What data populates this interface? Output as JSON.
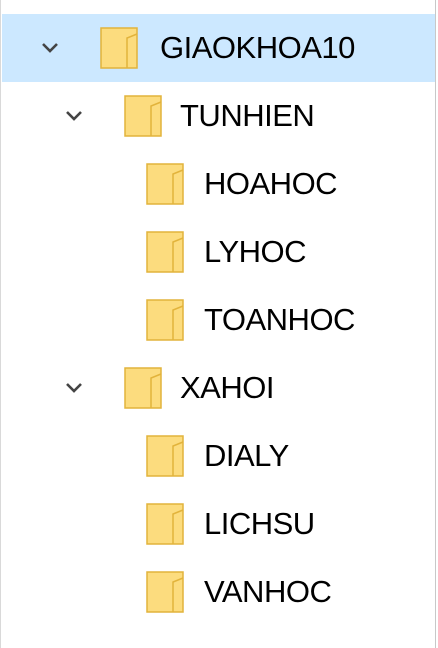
{
  "tree": {
    "root": {
      "label": "GIAOKHOA10",
      "expanded": true,
      "selected": true,
      "children": [
        {
          "label": "TUNHIEN",
          "expanded": true,
          "children": [
            {
              "label": "HOAHOC"
            },
            {
              "label": "LYHOC"
            },
            {
              "label": "TOANHOC"
            }
          ]
        },
        {
          "label": "XAHOI",
          "expanded": true,
          "children": [
            {
              "label": "DIALY"
            },
            {
              "label": "LICHSU"
            },
            {
              "label": "VANHOC"
            }
          ]
        }
      ]
    }
  },
  "icons": {
    "expand": "chevron-down-icon",
    "folder": "folder-icon"
  },
  "colors": {
    "selection": "#cce8ff",
    "folder_fill": "#fcdc7e",
    "folder_edge": "#e2b33b"
  }
}
